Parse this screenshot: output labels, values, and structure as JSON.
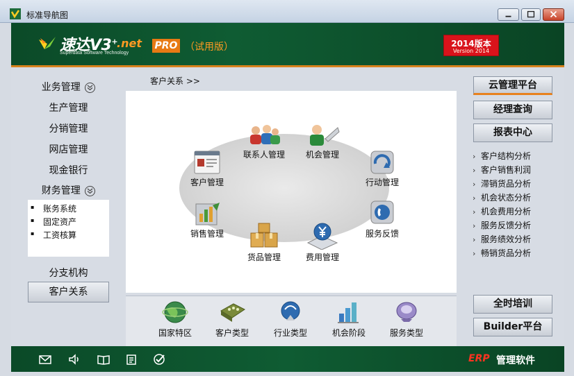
{
  "window": {
    "title": "标准导航图"
  },
  "banner": {
    "logo_text": "速达V3",
    "logo_plus": "+",
    "logo_net": ".net",
    "logo_sub": "Superdata Software Technology",
    "pro": "PRO",
    "trial": "（试用版）",
    "version_main": "2014版本",
    "version_sub": "Version 2014"
  },
  "left_menu": {
    "items": [
      {
        "label": "业务管理",
        "expandable": true
      },
      {
        "label": "生产管理"
      },
      {
        "label": "分销管理"
      },
      {
        "label": "网店管理"
      },
      {
        "label": "现金银行"
      },
      {
        "label": "财务管理",
        "expandable": true
      }
    ],
    "finance_sub": [
      "账务系统",
      "固定资产",
      "工资核算"
    ],
    "branch": "分支机构",
    "active_button": "客户关系"
  },
  "breadcrumb": "客户关系  >>",
  "modules": [
    {
      "label": "联系人管理",
      "icon": "contacts-icon"
    },
    {
      "label": "机会管理",
      "icon": "opportunity-icon"
    },
    {
      "label": "客户管理",
      "icon": "customer-icon"
    },
    {
      "label": "行动管理",
      "icon": "action-icon"
    },
    {
      "label": "销售管理",
      "icon": "sales-icon"
    },
    {
      "label": "服务反馈",
      "icon": "service-feedback-icon"
    },
    {
      "label": "货品管理",
      "icon": "goods-icon"
    },
    {
      "label": "费用管理",
      "icon": "expense-icon"
    }
  ],
  "bottom_tiles": [
    {
      "label": "国家特区",
      "icon": "globe-icon"
    },
    {
      "label": "客户类型",
      "icon": "customer-type-icon"
    },
    {
      "label": "行业类型",
      "icon": "industry-icon"
    },
    {
      "label": "机会阶段",
      "icon": "stage-chart-icon"
    },
    {
      "label": "服务类型",
      "icon": "service-type-icon"
    }
  ],
  "right_panel": {
    "buttons": [
      "云管理平台",
      "经理查询",
      "报表中心"
    ],
    "reports": [
      "客户结构分析",
      "客户销售利润",
      "滞销货品分析",
      "机会状态分析",
      "机会费用分析",
      "服务反馈分析",
      "服务绩效分析",
      "畅销货品分析"
    ],
    "bottom_buttons": [
      "全时培训",
      "Builder平台"
    ]
  },
  "footer": {
    "icons": [
      "mail-icon",
      "speaker-icon",
      "book-icon",
      "clipboard-icon",
      "check-icon"
    ],
    "erp": "ERP",
    "brand": "管理软件"
  },
  "colors": {
    "green": "#0f5c33",
    "orange": "#e8811d",
    "red": "#d9131b"
  }
}
